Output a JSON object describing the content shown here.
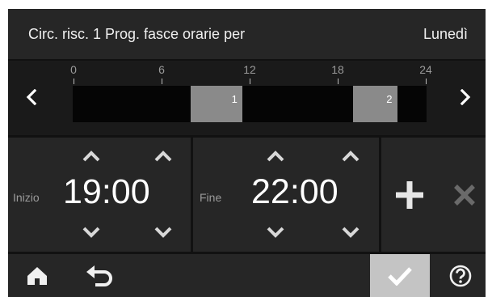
{
  "header": {
    "title": "Circ. risc. 1 Prog. fasce orarie per",
    "day": "Lunedì"
  },
  "timeline": {
    "hour_labels": [
      "0",
      "6",
      "12",
      "18",
      "24"
    ],
    "slots": [
      {
        "number": "1",
        "start": "08:00",
        "end": "11:30"
      },
      {
        "number": "2",
        "start": "19:00",
        "end": "22:00"
      }
    ]
  },
  "editor": {
    "start_label": "Inizio",
    "start_time": "19:00",
    "start_hours": "19",
    "start_minutes": "00",
    "end_label": "Fine",
    "end_time": "22:00",
    "end_hours": "22",
    "end_minutes": "00",
    "separator": ":"
  },
  "icons": {
    "prev": "chevron-left-icon",
    "next": "chevron-right-icon",
    "increment": "chevron-up-icon",
    "decrement": "chevron-down-icon",
    "add": "plus-icon",
    "delete": "close-icon",
    "home": "home-icon",
    "back": "undo-arrow-icon",
    "confirm": "checkmark-icon",
    "help": "question-circle-icon"
  },
  "colors": {
    "background": "#111111",
    "panel": "#262626",
    "slot": "#8a8a8a",
    "confirm_button": "#c4c4c4",
    "disabled_icon": "#6a6a6a"
  }
}
